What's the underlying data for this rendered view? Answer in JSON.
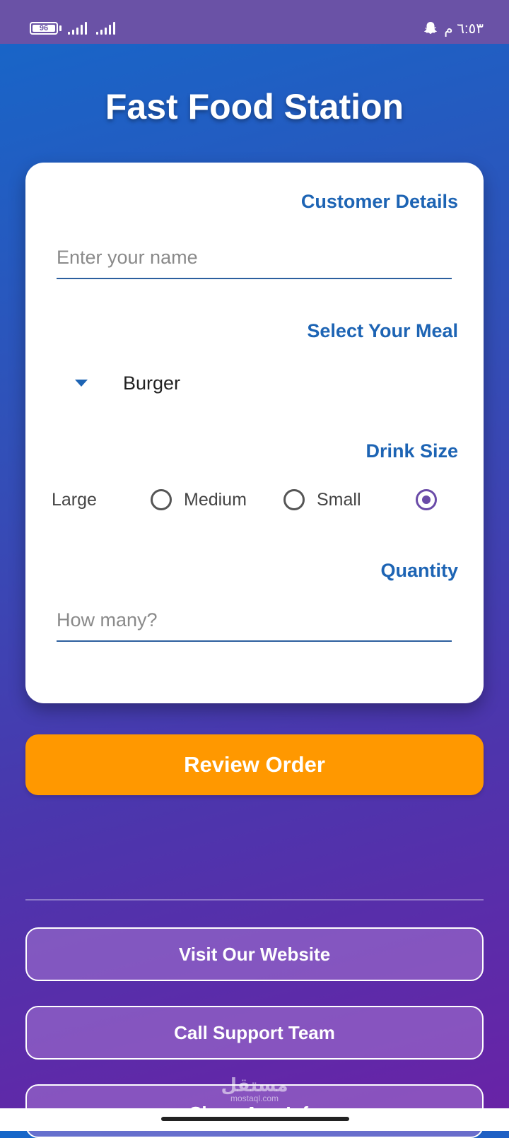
{
  "status_bar": {
    "battery": "96",
    "time": "٦:٥٣ م"
  },
  "app": {
    "title": "Fast Food Station"
  },
  "form": {
    "customer_details_heading": "Customer Details",
    "name_placeholder": "Enter your name",
    "meal_heading": "Select Your Meal",
    "meal_selected": "Burger",
    "drink_size_heading": "Drink Size",
    "drink_options": [
      {
        "label": "Large",
        "checked": true
      },
      {
        "label": "Medium",
        "checked": false
      },
      {
        "label": "Small",
        "checked": false
      }
    ],
    "quantity_heading": "Quantity",
    "quantity_placeholder": "How many?"
  },
  "actions": {
    "review_label": "Review Order",
    "links": [
      "Visit Our Website",
      "Call Support Team",
      "Share App Info"
    ]
  },
  "watermark": {
    "main": "مستقل",
    "sub": "mostaql.com"
  },
  "colors": {
    "accent": "#1d64b4",
    "primary_button": "#ff9800",
    "radio_checked": "#6a4ba8",
    "status_bar": "#6a52a6"
  }
}
